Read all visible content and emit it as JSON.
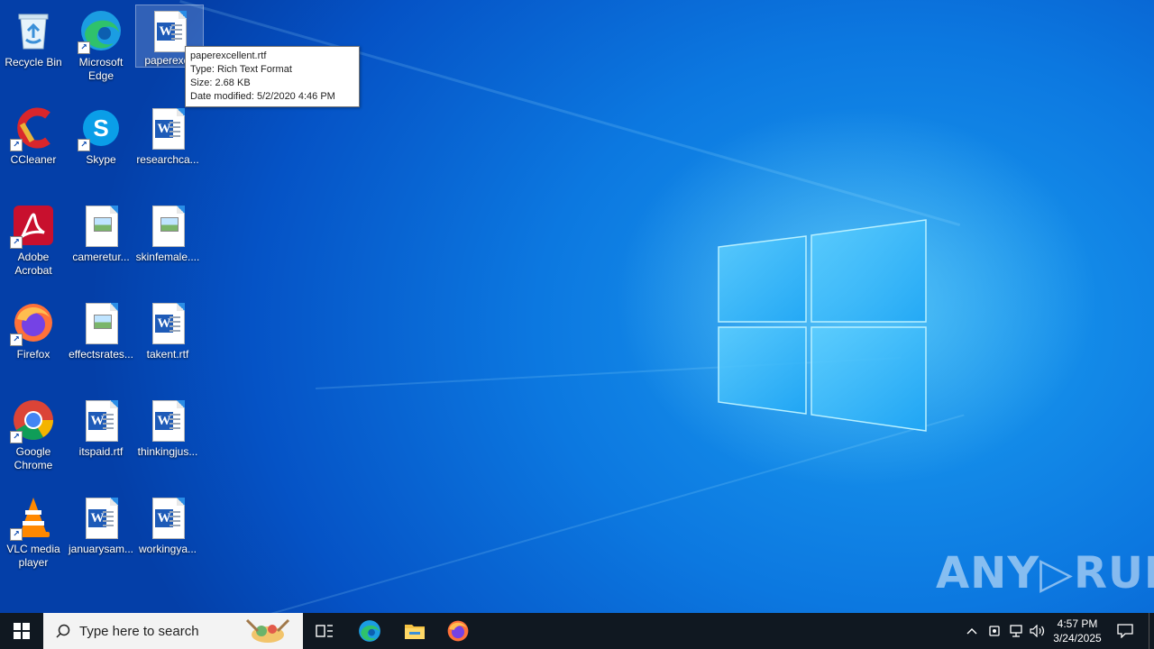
{
  "desktop": {
    "icons": [
      {
        "label": "Recycle Bin",
        "type": "recycle-bin"
      },
      {
        "label": "Microsoft Edge",
        "type": "edge"
      },
      {
        "label": "paperexcellent.rtf",
        "short_label": "paperexcc",
        "type": "word"
      },
      {
        "label": "CCleaner",
        "type": "ccleaner"
      },
      {
        "label": "Skype",
        "type": "skype"
      },
      {
        "label": "researchca...",
        "type": "word"
      },
      {
        "label": "Adobe Acrobat",
        "type": "acrobat"
      },
      {
        "label": "cameretur...",
        "type": "image"
      },
      {
        "label": "skinfemale....",
        "type": "image"
      },
      {
        "label": "Firefox",
        "type": "firefox"
      },
      {
        "label": "effectsrates...",
        "type": "image"
      },
      {
        "label": "takent.rtf",
        "type": "word"
      },
      {
        "label": "Google Chrome",
        "type": "chrome"
      },
      {
        "label": "itspaid.rtf",
        "type": "word"
      },
      {
        "label": "thinkingjus...",
        "type": "word"
      },
      {
        "label": "VLC media player",
        "type": "vlc"
      },
      {
        "label": "januarysam...",
        "type": "word"
      },
      {
        "label": "workingya...",
        "type": "word"
      }
    ],
    "tooltip": {
      "line1": "paperexcellent.rtf",
      "line2": "Type: Rich Text Format",
      "line3": "Size: 2.68 KB",
      "line4": "Date modified: 5/2/2020 4:46 PM"
    },
    "watermark": "ANY▷RUN"
  },
  "taskbar": {
    "search_placeholder": "Type here to search",
    "pinned": [
      "task-view",
      "edge",
      "file-explorer",
      "firefox"
    ],
    "clock_time": "4:57 PM",
    "clock_date": "3/24/2025"
  },
  "colors": {
    "desktop_blue": "#0c78e0",
    "taskbar": "#101821"
  }
}
